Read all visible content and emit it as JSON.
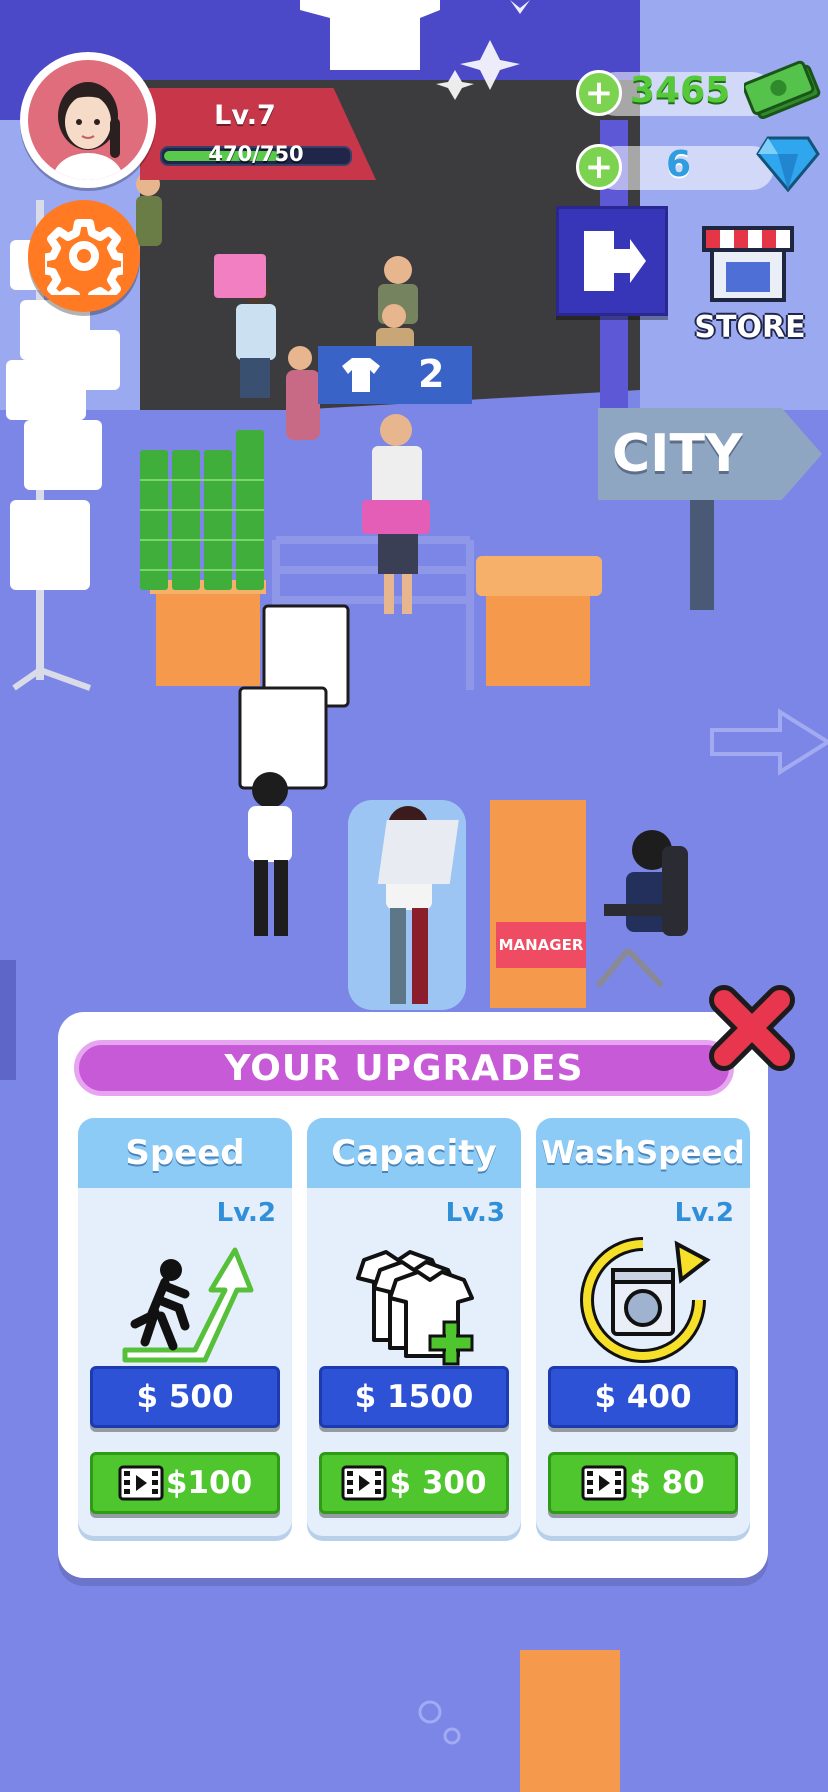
{
  "hud": {
    "level": "Lv.7",
    "xp_text": "470/750",
    "xp_fraction": 0.627,
    "cash": "3465",
    "gems": "6"
  },
  "actions": {
    "store_label": "STORE"
  },
  "world": {
    "customer_count": "2",
    "city_sign": "CITY",
    "manager_sign": "MANAGER"
  },
  "upgrades": {
    "title": "YOUR UPGRADES",
    "cards": [
      {
        "name": "Speed",
        "level": "Lv.2",
        "price": "$ 500",
        "ad_price": "$100",
        "icon": "runner-arrow-icon"
      },
      {
        "name": "Capacity",
        "level": "Lv.3",
        "price": "$ 1500",
        "ad_price": "$ 300",
        "icon": "shirts-plus-icon"
      },
      {
        "name": "WashSpeed",
        "level": "Lv.2",
        "price": "$ 400",
        "ad_price": "$ 80",
        "icon": "washing-machine-cycle-icon"
      }
    ]
  },
  "colors": {
    "floor": "#7c86e6",
    "panel_header": "#c75ad6",
    "buy_button": "#2d52d6",
    "ad_button": "#4fc62d",
    "close": "#e8364e"
  }
}
